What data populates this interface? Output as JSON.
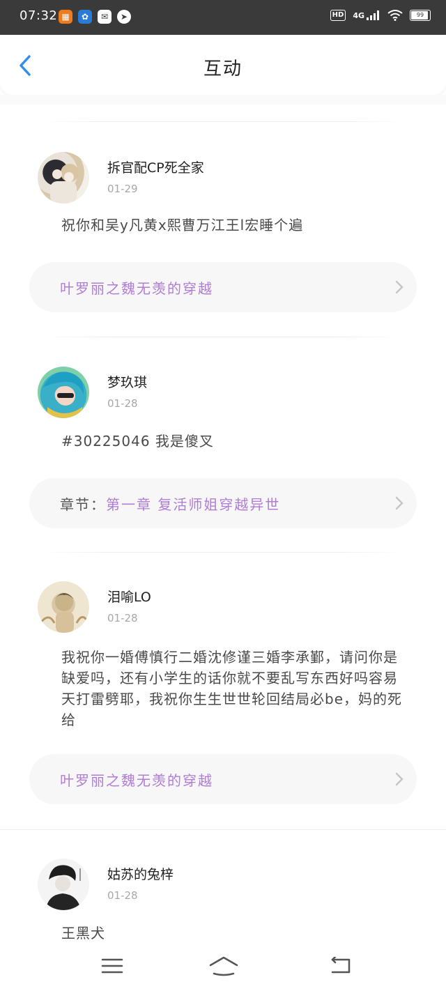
{
  "status_bar": {
    "time": "07:32",
    "hd": "HD",
    "network": "4G",
    "battery": "99"
  },
  "header": {
    "title": "互动"
  },
  "comments": [
    {
      "username": "拆官配CP死全家",
      "date": "01-29",
      "text": "祝你和吴y凡黄x熙曹万江王l宏睡个遍",
      "link_prefix": "",
      "link_text": "叶罗丽之魏无羡的穿越"
    },
    {
      "username": "梦玖琪",
      "date": "01-28",
      "text": "#30225046 我是傻叉",
      "link_prefix": "章节：",
      "link_text": "第一章 复活师姐穿越异世"
    },
    {
      "username": "泪喻LO",
      "date": "01-28",
      "text": "我祝你一婚傅慎行二婚沈修谨三婚李承鄞，请问你是缺爱吗，还有小学生的话你就不要乱写东西好吗容易天打雷劈耶，我祝你生生世世轮回结局必be，妈的死给",
      "link_prefix": "",
      "link_text": "叶罗丽之魏无羡的穿越"
    },
    {
      "username": "姑苏的兔梓",
      "date": "01-28",
      "text": "王黑犬"
    }
  ],
  "colors": {
    "accent_blue": "#2f8fe8",
    "link_purple": "#b07dd6"
  }
}
